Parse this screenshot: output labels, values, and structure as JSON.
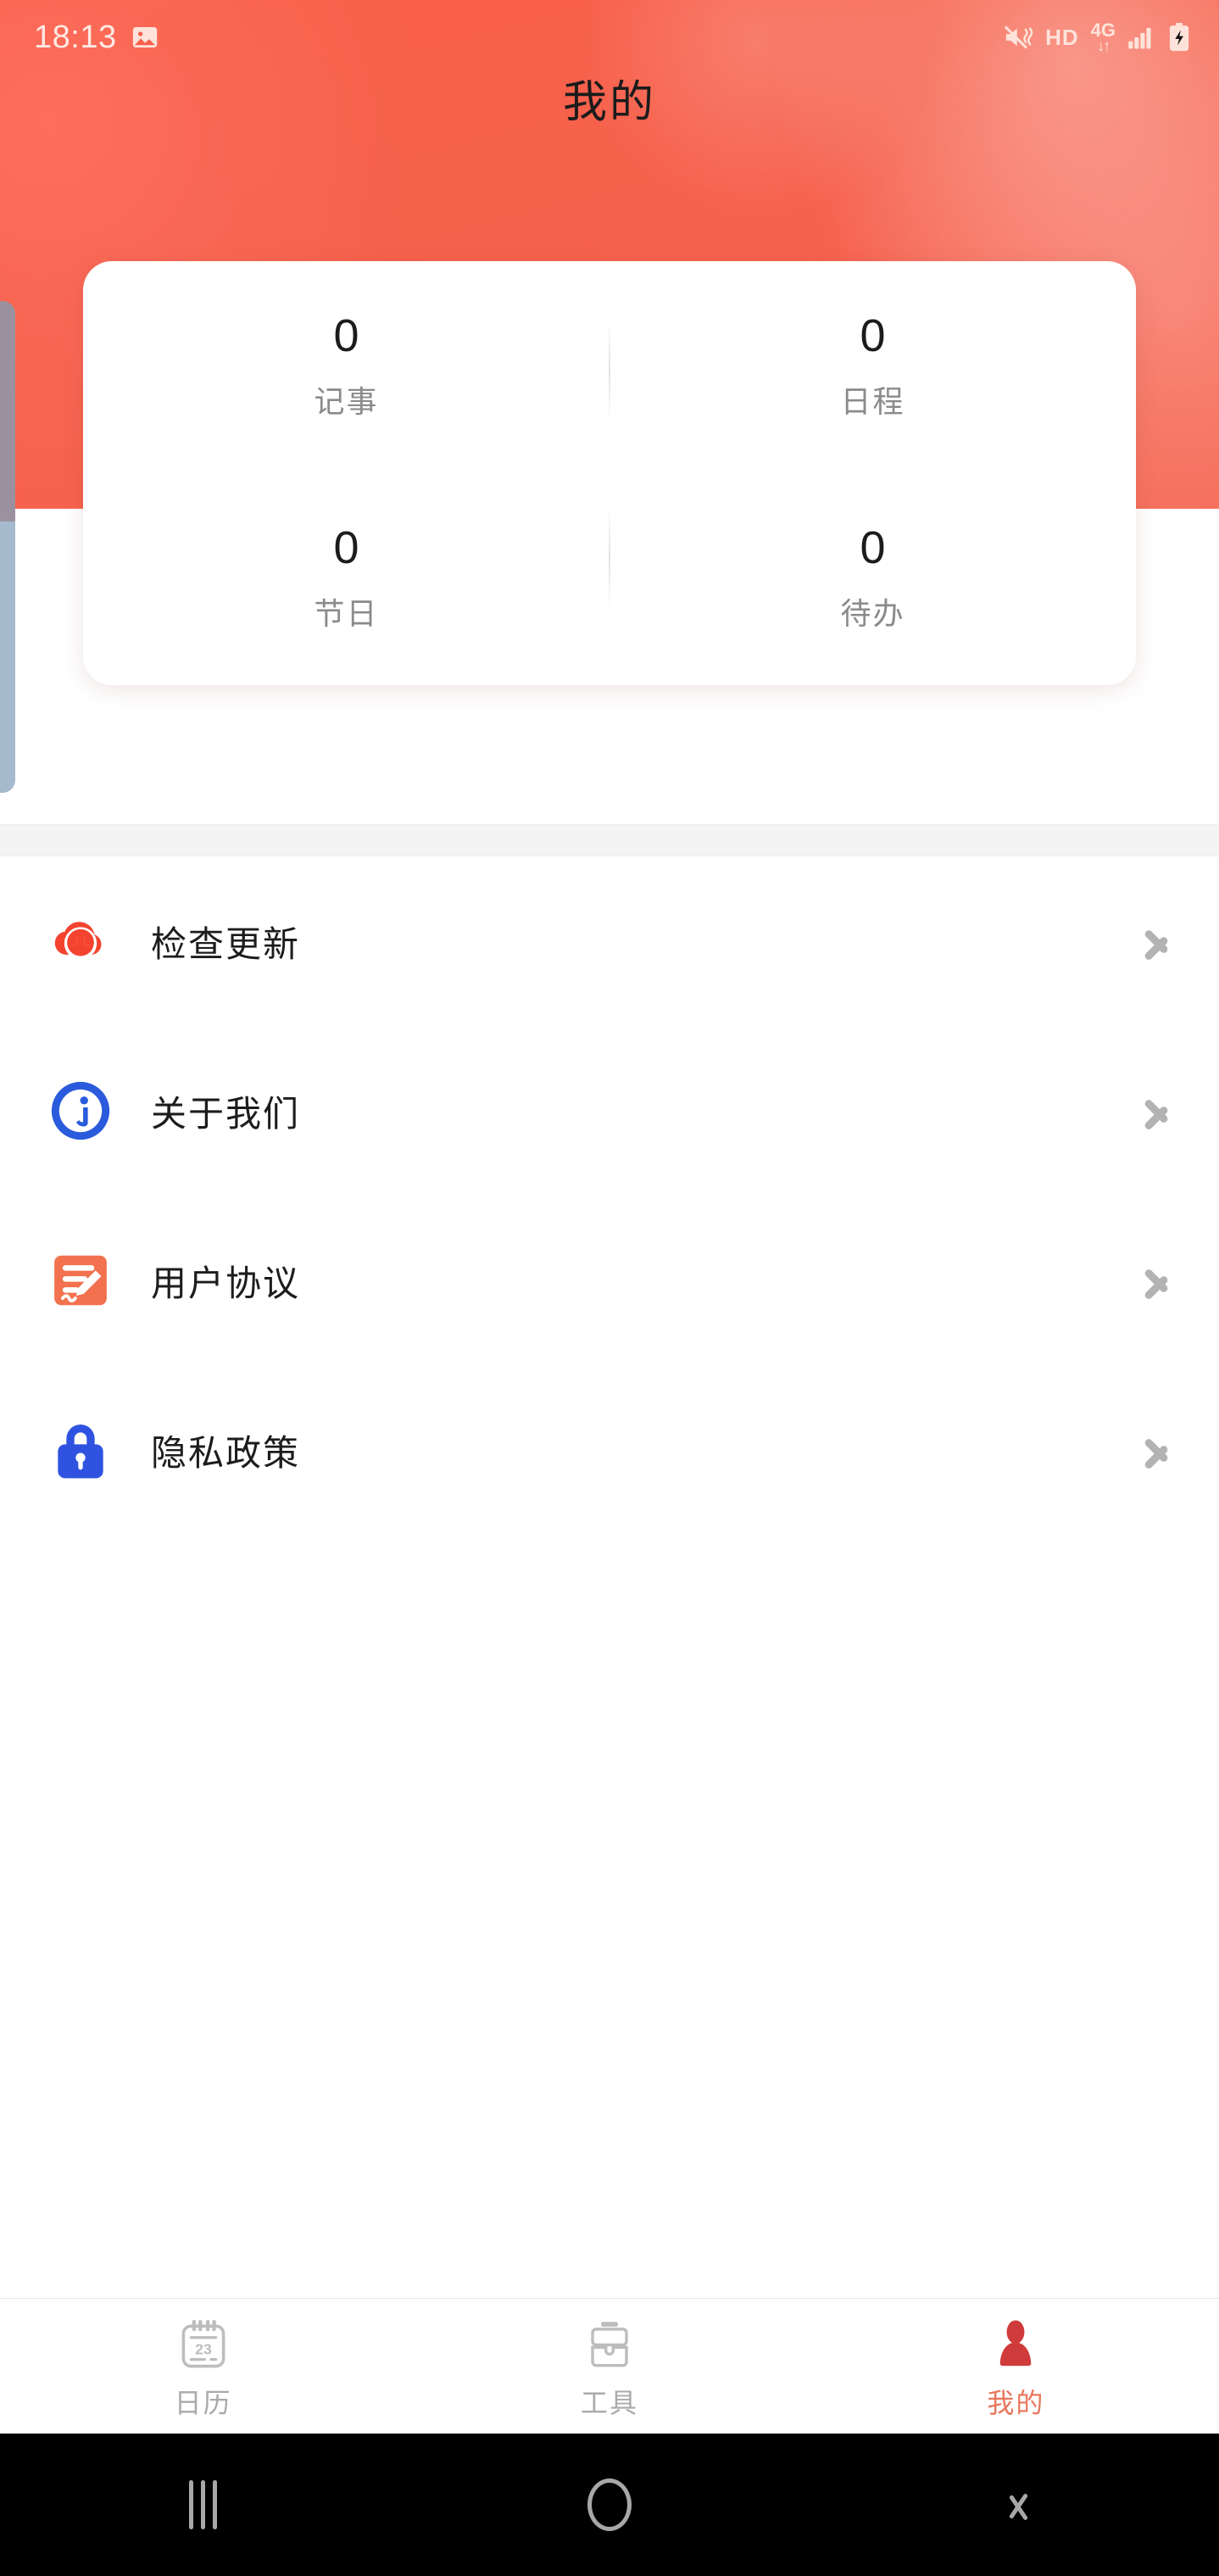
{
  "status_bar": {
    "time": "18:13",
    "photo_icon": "image-icon",
    "mute_icon": "vibrate-mute-icon",
    "hd_label": "HD",
    "network_label": "4G",
    "data_arrows": "↓↑",
    "signal_icon": "signal-bars-icon",
    "battery_icon": "battery-charging-icon"
  },
  "header": {
    "title": "我的",
    "accent_color": "#f6614c",
    "edge_handle": "edge-drawer-handle"
  },
  "stats": {
    "items": [
      {
        "value": "0",
        "label": "记事"
      },
      {
        "value": "0",
        "label": "日程"
      },
      {
        "value": "0",
        "label": "节日"
      },
      {
        "value": "0",
        "label": "待办"
      }
    ]
  },
  "menu": {
    "items": [
      {
        "label": "检查更新",
        "icon": "cloud-download-icon",
        "color": "#f4432f"
      },
      {
        "label": "关于我们",
        "icon": "info-circle-icon",
        "color": "#2a5bdc"
      },
      {
        "label": "用户协议",
        "icon": "document-pen-icon",
        "color": "#f2714f"
      },
      {
        "label": "隐私政策",
        "icon": "lock-icon",
        "color": "#2f53e0"
      }
    ],
    "chevron_icon": "chevron-right-icon"
  },
  "tabbar": {
    "active_color": "#e8765b",
    "inactive_color": "#aaaaaa",
    "tabs": [
      {
        "label": "日历",
        "icon": "calendar-icon",
        "badge": "23",
        "active": false
      },
      {
        "label": "工具",
        "icon": "toolbox-icon",
        "active": false
      },
      {
        "label": "我的",
        "icon": "person-icon",
        "active": true
      }
    ]
  },
  "android_nav": {
    "recents_label": "recents-button",
    "home_label": "home-button",
    "back_label": "back-button"
  }
}
